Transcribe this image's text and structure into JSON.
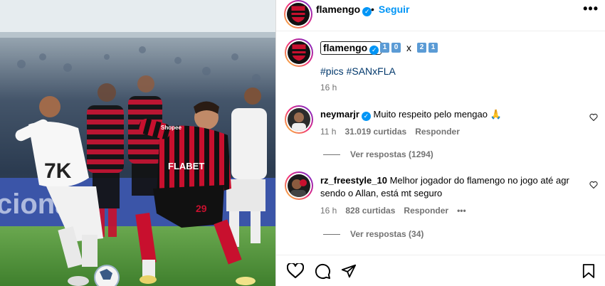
{
  "post": {
    "author": "flamengo",
    "follow_label": "Seguir",
    "dot_separator": "•",
    "more_label": "•••"
  },
  "caption": {
    "author": "flamengo",
    "score_home": "1",
    "score_home2": "0",
    "score_sep": "x",
    "score_away": "2",
    "score_away2": "1",
    "hashtag_1": "#pics",
    "hashtag_2": "#SANxFLA",
    "time": "16 h"
  },
  "comments": [
    {
      "user": "neymarjr",
      "verified": true,
      "text": "Muito respeito pelo mengao",
      "emoji": "🙏",
      "time": "11 h",
      "likes": "31.019 curtidas",
      "reply_label": "Responder",
      "view_replies": "Ver respostas (1294)"
    },
    {
      "user": "rz_freestyle_10",
      "verified": false,
      "text": "Melhor jogador do flamengo no jogo até agr sendo o Allan, está mt seguro",
      "time": "16 h",
      "likes": "828 curtidas",
      "reply_label": "Responder",
      "more_label": "•••",
      "view_replies": "Ver respostas (34)"
    }
  ],
  "actions": {
    "icons": [
      "heart-icon",
      "comment-icon",
      "share-icon",
      "save-icon"
    ]
  },
  "colors": {
    "link_blue": "#0095f6",
    "hashtag_blue": "#00376b",
    "meta_gray": "#737373",
    "flamengo_red": "#c8102e"
  },
  "photo": {
    "jersey_sponsor_1": "FLABET",
    "jersey_sponsor_2": "7K",
    "jersey_sponsor_3": "Shopee",
    "shirt_number": "29"
  }
}
